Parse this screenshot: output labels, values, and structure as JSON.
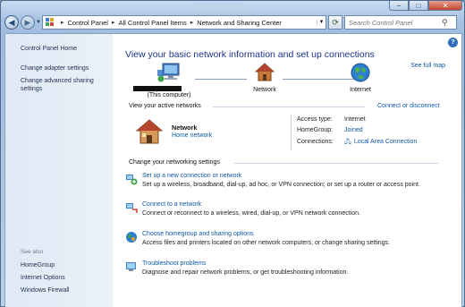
{
  "window": {
    "controls": {
      "minimize": "−",
      "maximize": "□",
      "close": "✕"
    }
  },
  "address_bar": {
    "crumbs": [
      "Control Panel",
      "All Control Panel Items",
      "Network and Sharing Center"
    ],
    "search_placeholder": "Search Control Panel"
  },
  "sidebar": {
    "links": [
      "Control Panel Home",
      "Change adapter settings",
      "Change advanced sharing settings"
    ],
    "see_also_label": "See also",
    "see_also": [
      "HomeGroup",
      "Internet Options",
      "Windows Firewall"
    ]
  },
  "main": {
    "heading": "View your basic network information and set up connections",
    "see_full_map": "See full map",
    "map": {
      "computer_label": "(This computer)",
      "network_label": "Network",
      "internet_label": "Internet"
    },
    "active_networks": {
      "heading": "View your active networks",
      "connect_link": "Connect or disconnect",
      "network_name": "Network",
      "network_type": "Home network",
      "access_type_label": "Access type:",
      "access_type_value": "Internet",
      "homegroup_label": "HomeGroup:",
      "homegroup_value": "Joined",
      "connections_label": "Connections:",
      "connections_value": "Local Area Connection"
    },
    "settings": {
      "heading": "Change your networking settings",
      "tasks": [
        {
          "title": "Set up a new connection or network",
          "desc": "Set up a wireless, broadband, dial-up, ad hoc, or VPN connection; or set up a router or access point."
        },
        {
          "title": "Connect to a network",
          "desc": "Connect or reconnect to a wireless, wired, dial-up, or VPN network connection."
        },
        {
          "title": "Choose homegroup and sharing options",
          "desc": "Access files and printers located on other network computers, or change sharing settings."
        },
        {
          "title": "Troubleshoot problems",
          "desc": "Diagnose and repair network problems, or get troubleshooting information."
        }
      ]
    }
  },
  "colors": {
    "link": "#0d58a8",
    "heading": "#1e3287",
    "sidebar_bg": "#dfe9f5"
  }
}
